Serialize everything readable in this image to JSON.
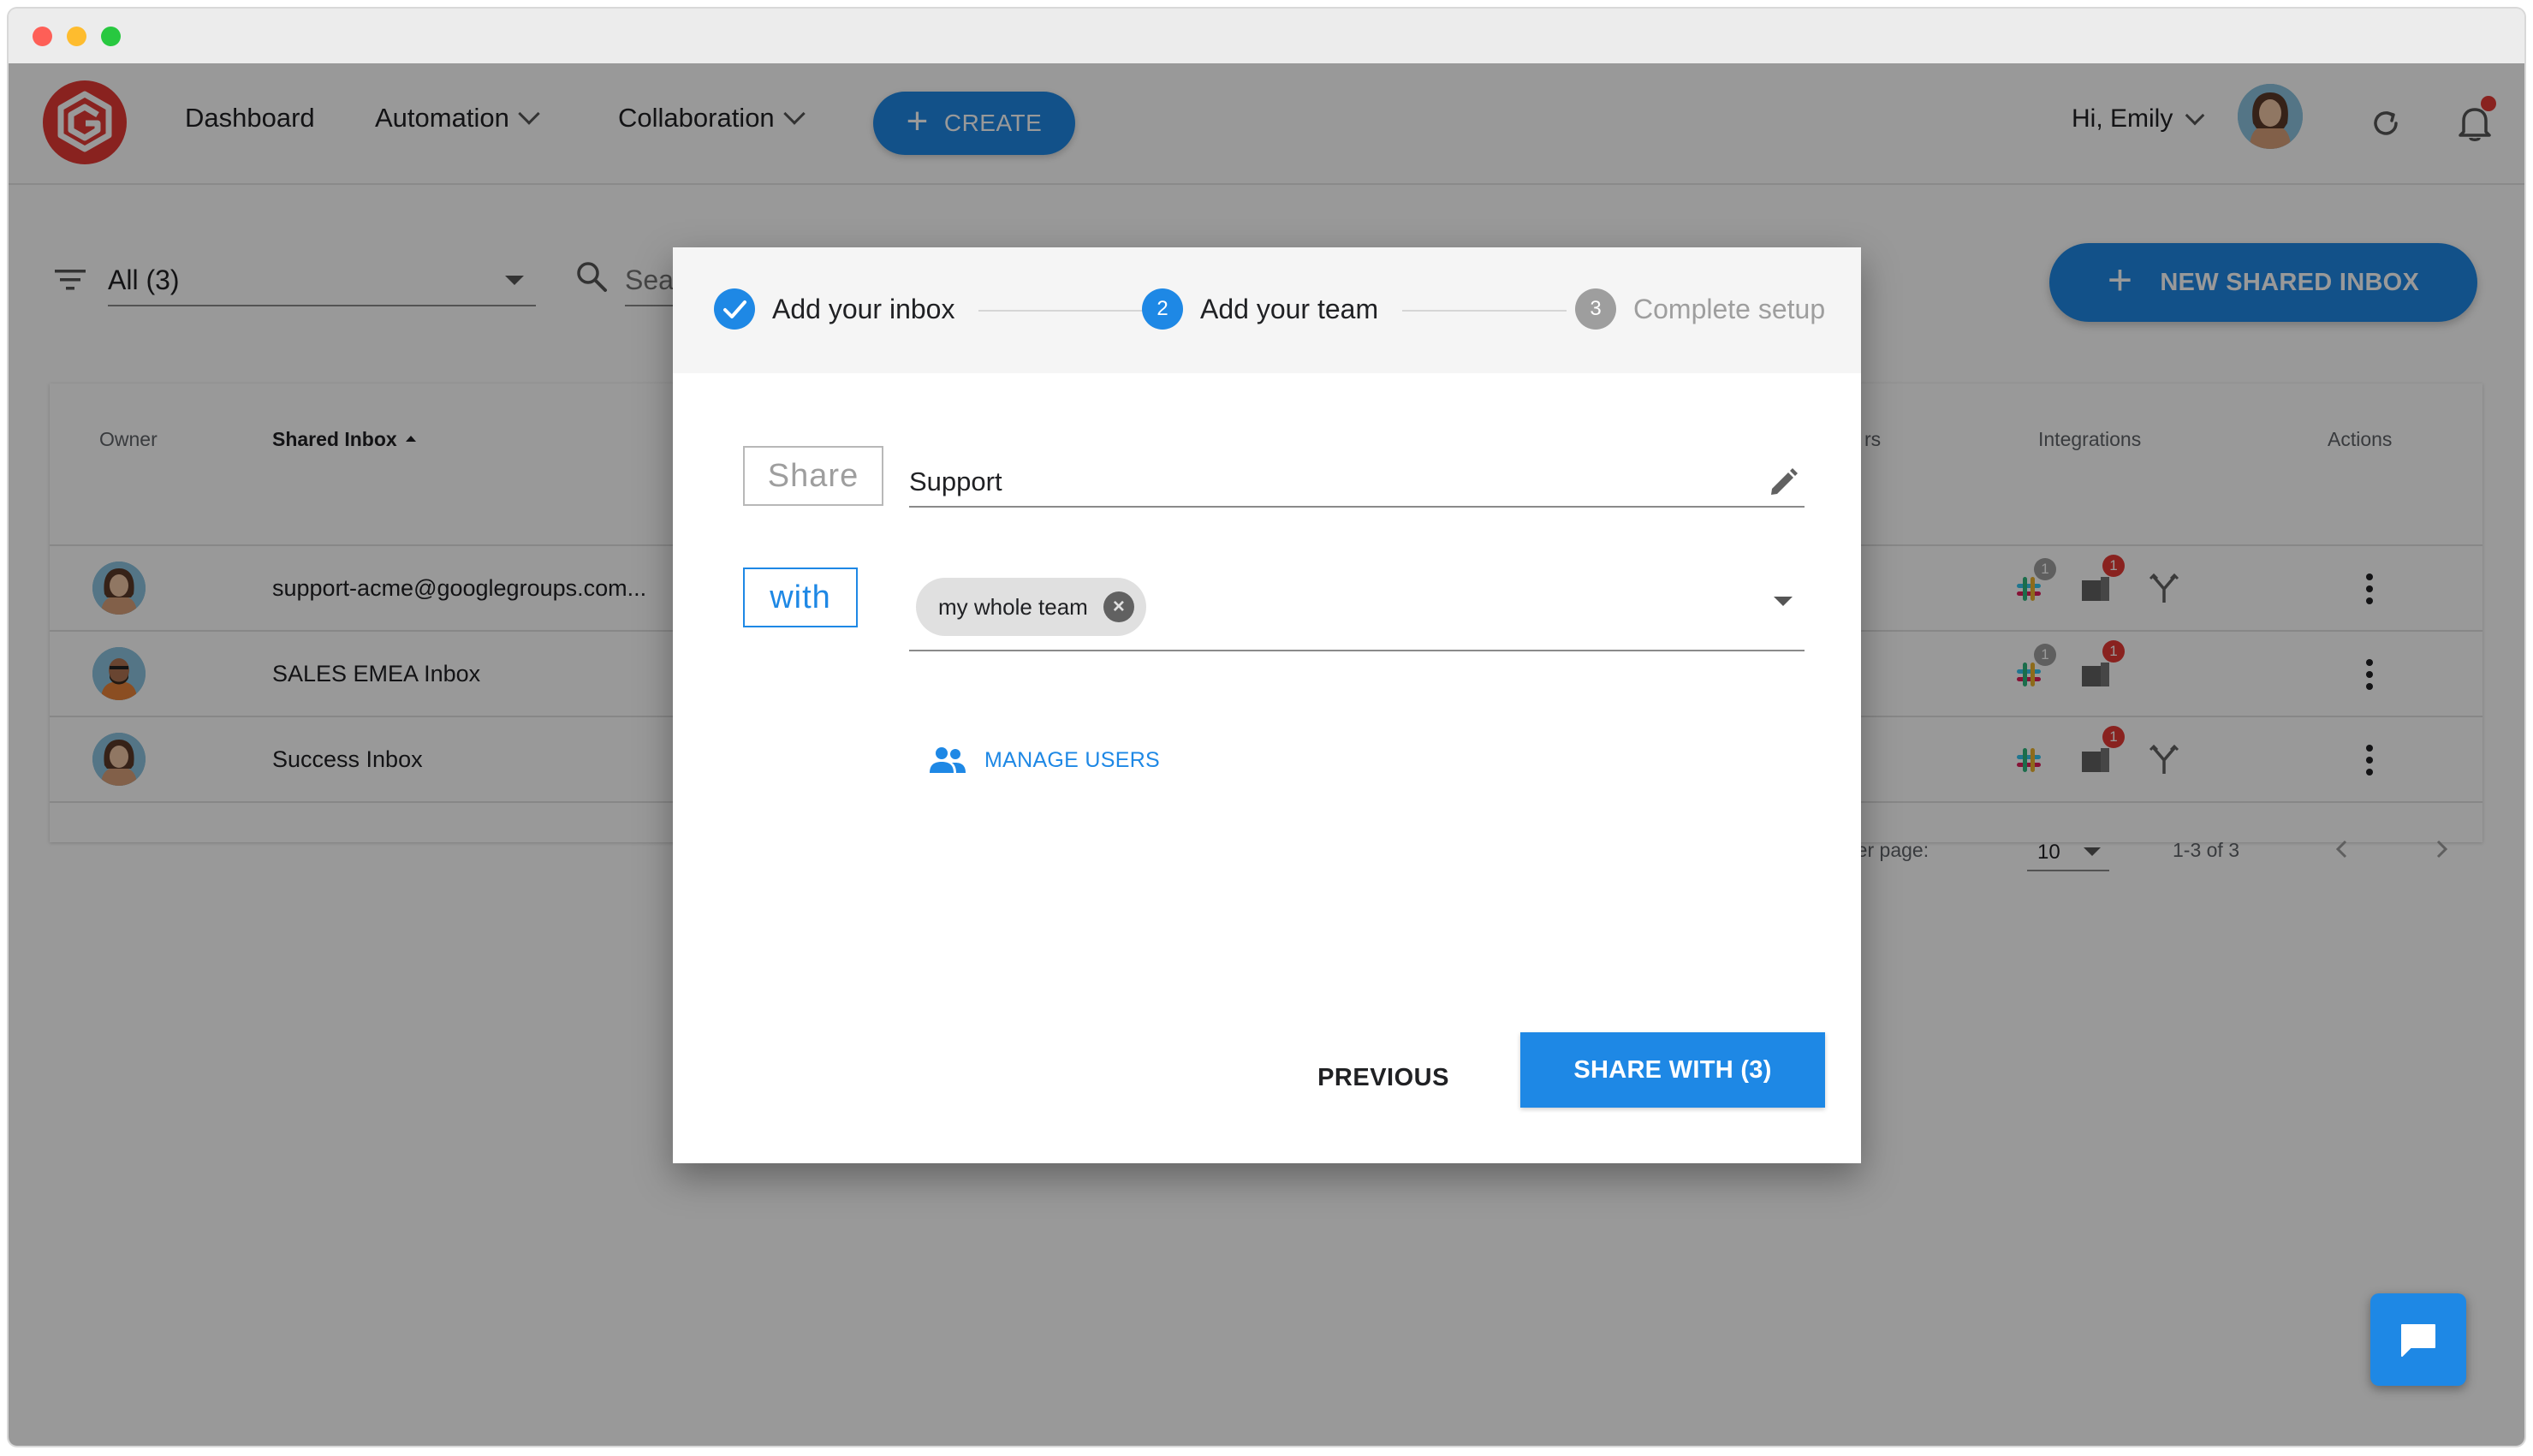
{
  "nav": {
    "dashboard": "Dashboard",
    "automation": "Automation",
    "collaboration": "Collaboration",
    "create": "CREATE",
    "greeting": "Hi, Emily"
  },
  "toolbar": {
    "filter_value": "All (3)",
    "search_placeholder": "Search by name",
    "new_inbox": "NEW SHARED INBOX"
  },
  "table": {
    "headers": {
      "owner": "Owner",
      "shared_inbox": "Shared Inbox",
      "members_partial": "rs",
      "integrations": "Integrations",
      "actions": "Actions"
    },
    "rows": [
      {
        "name": "support-acme@googlegroups.com...",
        "slack_badge": "1",
        "puzzle_badge": "1",
        "fork": true
      },
      {
        "name": "SALES EMEA Inbox",
        "slack_badge": "1",
        "puzzle_badge": "1",
        "fork": false
      },
      {
        "name": "Success Inbox",
        "slack_badge": "",
        "puzzle_badge": "1",
        "fork": true
      }
    ],
    "pager": {
      "label": "s per page:",
      "per_page": "10",
      "range": "1-3 of 3"
    }
  },
  "dialog": {
    "steps": [
      {
        "num": "",
        "label": "Add your inbox",
        "state": "done"
      },
      {
        "num": "2",
        "label": "Add your team",
        "state": "active"
      },
      {
        "num": "3",
        "label": "Complete setup",
        "state": "pending"
      }
    ],
    "share_label": "Share",
    "inbox_name": "Support",
    "with_label": "with",
    "chip": "my whole team",
    "manage_users": "MANAGE USERS",
    "previous": "PREVIOUS",
    "share_with": "SHARE WITH (3)"
  },
  "colors": {
    "accent": "#1e88e5",
    "brand": "#e53935",
    "badge_red": "#e53935"
  },
  "icons": [
    "filter-icon",
    "search-icon",
    "refresh-icon",
    "bell-icon",
    "pencil-icon",
    "manage-users-icon",
    "chat-icon",
    "slack-icon",
    "puzzle-icon",
    "fork-icon"
  ]
}
